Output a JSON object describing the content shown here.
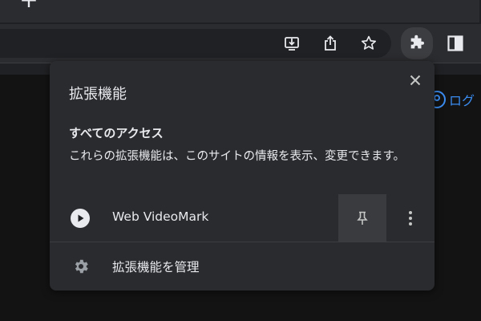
{
  "tabstrip": {
    "new_tab_symbol": "+"
  },
  "toolbar": {
    "icons": [
      "install-icon",
      "share-icon",
      "bookmark-star-icon",
      "extensions-puzzle-icon",
      "side-panel-icon"
    ]
  },
  "page": {
    "login_text": "ログ"
  },
  "popup": {
    "title": "拡張機能",
    "close_icon": "close-icon",
    "section_heading": "すべてのアクセス",
    "section_desc": "これらの拡張機能は、このサイトの情報を表示、変更できます。",
    "extension": {
      "name": "Web VideoMark",
      "icon": "play-circle-icon",
      "pin_icon": "pin-icon",
      "more_icon": "more-vert-icon"
    },
    "manage_label": "拡張機能を管理",
    "manage_icon": "gear-icon"
  },
  "colors": {
    "accent": "#3b8cf0",
    "popup_bg": "#2a2b2e",
    "text": "#e8eaed"
  }
}
